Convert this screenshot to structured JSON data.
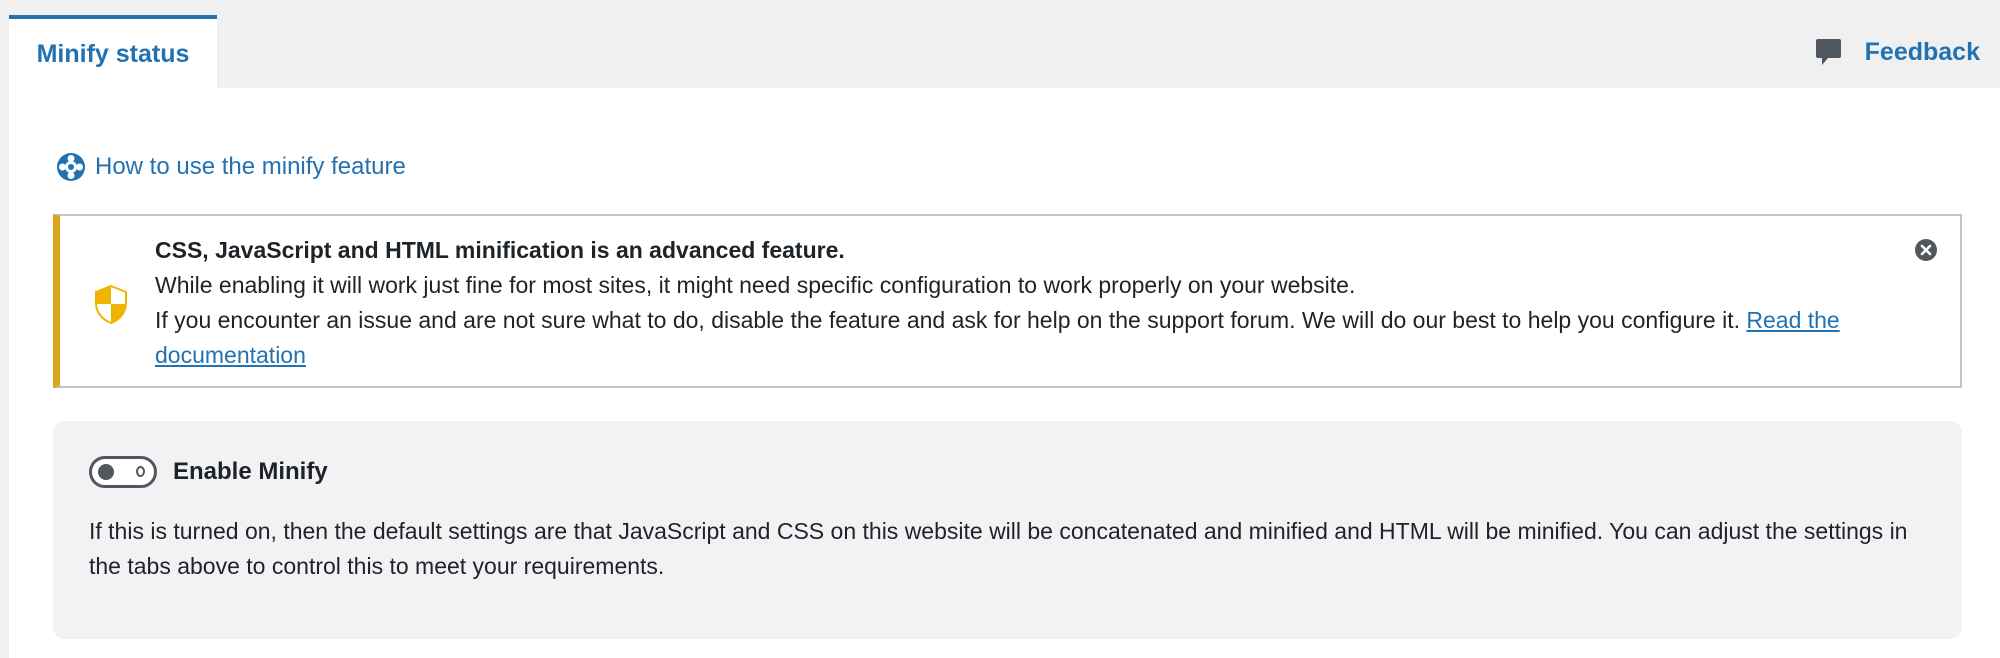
{
  "tabs": {
    "active_label": "Minify status",
    "feedback_label": "Feedback"
  },
  "help_link": {
    "label": "How to use the minify feature"
  },
  "notice": {
    "title": "CSS, JavaScript and HTML minification is an advanced feature.",
    "line1": "While enabling it will work just fine for most sites, it might need specific configuration to work properly on your website.",
    "line2": "If you encounter an issue and are not sure what to do, disable the feature and ask for help on the support forum. We will do our best to help you configure it.",
    "link_text": "Read the documentation"
  },
  "minify": {
    "toggle_label": "Enable Minify",
    "toggle_state": "off",
    "description": "If this is turned on, then the default settings are that JavaScript and CSS on this website will be concatenated and minified and HTML will be minified. You can adjust the settings in the tabs above to control this to meet your requirements."
  },
  "icons": {
    "feedback": "speech-bubble-icon",
    "help": "lifebuoy-icon",
    "notice": "shield-icon",
    "dismiss": "close-circle-icon"
  },
  "colors": {
    "accent": "#2271b1",
    "warning_border": "#dba617",
    "shield_yellow": "#f0b400"
  }
}
